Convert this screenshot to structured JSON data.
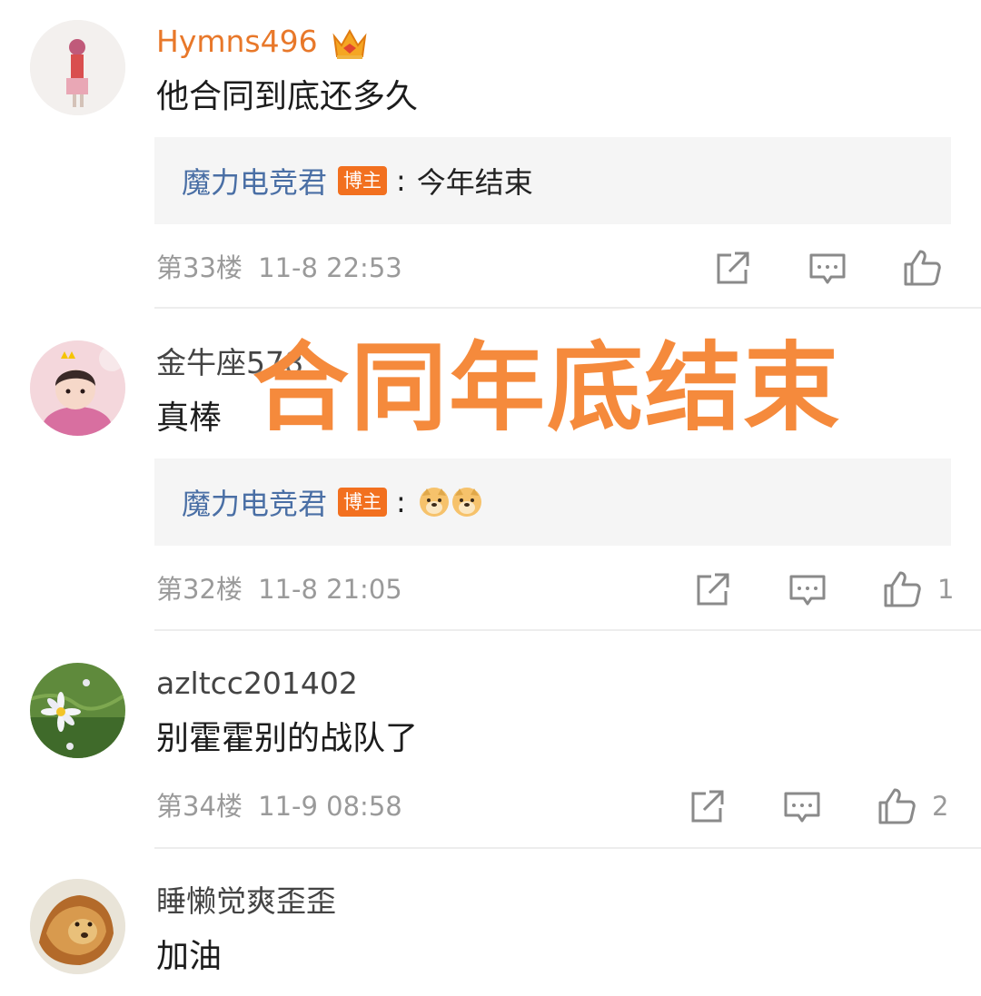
{
  "overlay": {
    "title": "合同年底结束"
  },
  "comments": [
    {
      "username": "Hymns496",
      "text": "他合同到底还多久",
      "reply": {
        "name": "魔力电竞君",
        "badge": "博主",
        "colon": ":",
        "text": "今年结束"
      },
      "floor": "第33楼",
      "time": "11-8 22:53",
      "likes": ""
    },
    {
      "username": "金牛座578",
      "text": "真棒",
      "reply": {
        "name": "魔力电竞君",
        "badge": "博主",
        "colon": ":",
        "text": "",
        "emojis": [
          "doge-emoji",
          "doge-emoji"
        ]
      },
      "floor": "第32楼",
      "time": "11-8 21:05",
      "likes": "1"
    },
    {
      "username": "azltcc201402",
      "text": "别霍霍别的战队了",
      "floor": "第34楼",
      "time": "11-9 08:58",
      "likes": "2"
    },
    {
      "username": "睡懒觉爽歪歪",
      "text": "加油"
    }
  ],
  "icons": {
    "share": "share-icon",
    "comment": "comment-icon",
    "like": "thumbs-up-icon",
    "crown": "crown-icon"
  },
  "colors": {
    "vip_username": "#e8782a",
    "reply_name": "#4a6fa5",
    "badge": "#f2701f",
    "overlay": "#f58a3c",
    "meta": "#9a9a9a"
  }
}
